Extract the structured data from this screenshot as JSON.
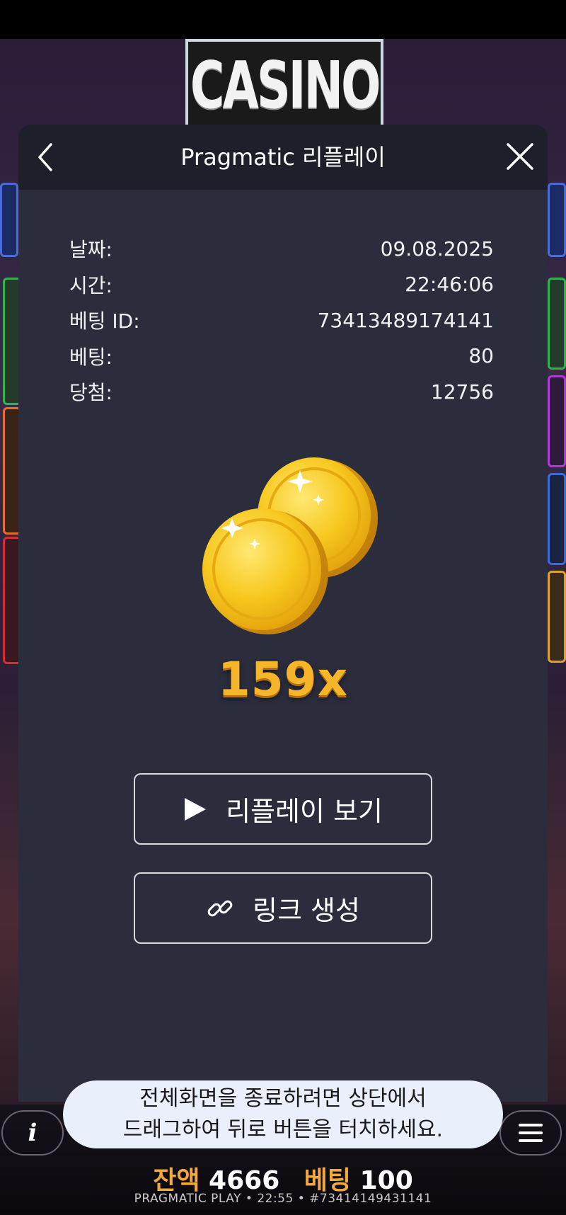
{
  "background": {
    "sign_text": "CASINO",
    "balance_label": "잔액",
    "balance_value": "4666",
    "bet_label": "베팅",
    "bet_value": "100",
    "footer": "PRAGMATIC PLAY • 22:55 • #73414149431141",
    "info_icon_glyph": "i",
    "colors": {
      "balance_label": "#f2a93b",
      "bottom_bar": "#0b090e"
    }
  },
  "modal": {
    "title": "Pragmatic 리플레이",
    "back_icon": "chevron-left-icon",
    "close_icon": "close-icon",
    "details": [
      {
        "label": "날짜:",
        "value": "09.08.2025"
      },
      {
        "label": "시간:",
        "value": "22:46:06"
      },
      {
        "label": "베팅 ID:",
        "value": "73413489174141"
      },
      {
        "label": "베팅:",
        "value": "80"
      },
      {
        "label": "당첨:",
        "value": "12756"
      }
    ],
    "multiplier": "159x",
    "buttons": {
      "replay_label": "리플레이 보기",
      "replay_icon": "play-icon",
      "link_label": "링크 생성",
      "link_icon": "link-icon"
    },
    "colors": {
      "background": "#2b2d3d",
      "header": "#1d1f2b",
      "multiplier": "#f7b52a"
    }
  },
  "toast": {
    "line1": "전체화면을 종료하려면 상단에서",
    "line2": "드래그하여 뒤로 버튼을 터치하세요."
  }
}
